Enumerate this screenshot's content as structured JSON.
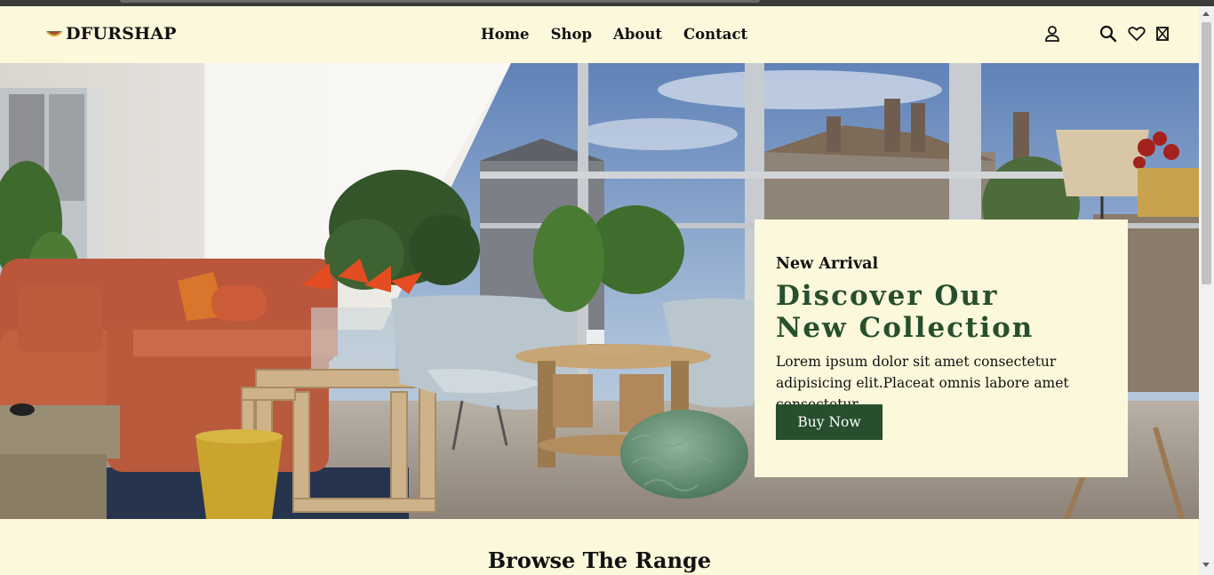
{
  "brand": {
    "name": "DFURSHAP",
    "logo_icon": "bowl-logo-icon"
  },
  "nav": {
    "items": [
      "Home",
      "Shop",
      "About",
      "Contact"
    ]
  },
  "header_icons": [
    "user-icon",
    "search-icon",
    "heart-icon",
    "cart-icon"
  ],
  "hero": {
    "kicker": "New Arrival",
    "headline_line1": "Discover Our",
    "headline_line2": "New Collection",
    "body": "Lorem ipsum dolor sit amet consectetur adipisicing elit.Placeat omnis labore amet consectetur",
    "cta_label": "Buy Now"
  },
  "section": {
    "title": "Browse The Range"
  },
  "colors": {
    "background": "#fcf8db",
    "accent": "#274f2e",
    "text": "#111111"
  }
}
